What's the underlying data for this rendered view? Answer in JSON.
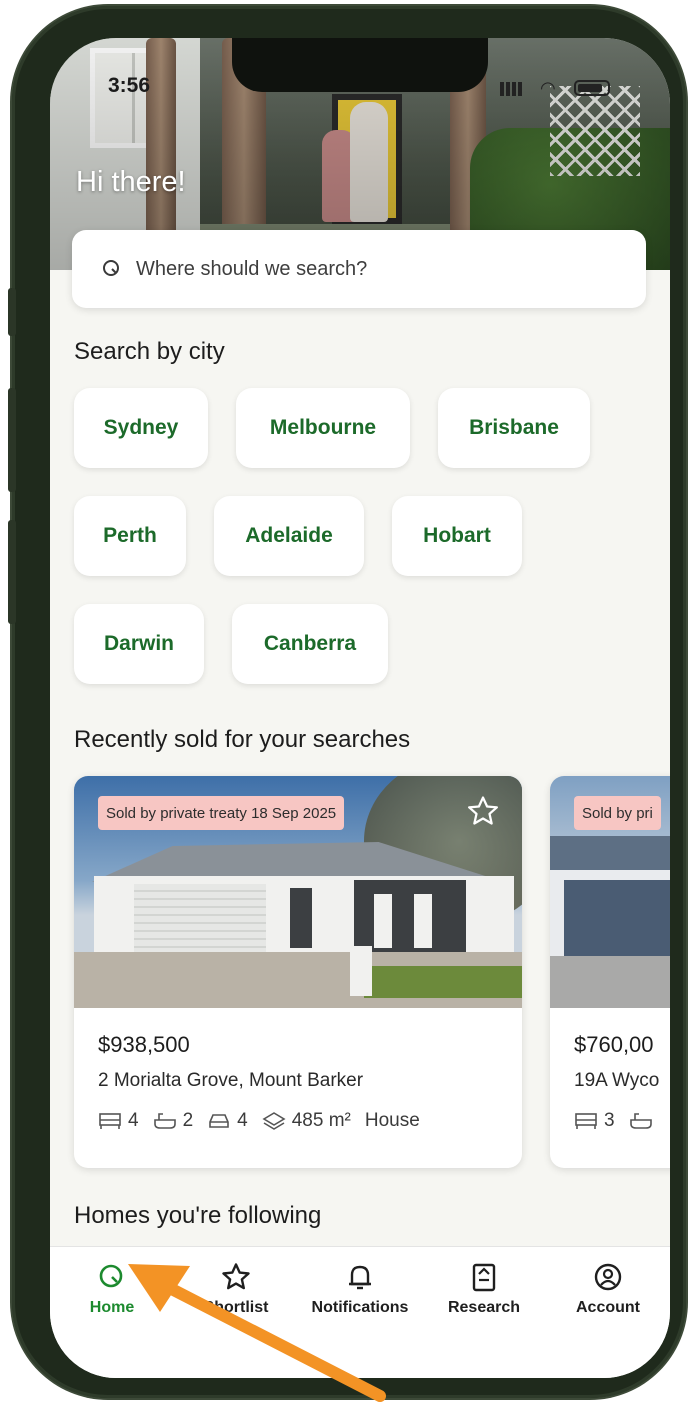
{
  "status_bar": {
    "time": "3:56"
  },
  "header": {
    "greeting": "Hi there!"
  },
  "search": {
    "placeholder": "Where should we search?"
  },
  "cities": {
    "title": "Search by city",
    "items": [
      "Sydney",
      "Melbourne",
      "Brisbane",
      "Perth",
      "Adelaide",
      "Hobart",
      "Darwin",
      "Canberra"
    ]
  },
  "recently_sold": {
    "title": "Recently sold for your searches",
    "listings": [
      {
        "sold_label": "Sold by private treaty 18 Sep 2025",
        "price": "$938,500",
        "address": "2 Morialta Grove, Mount Barker",
        "beds": "4",
        "baths": "2",
        "cars": "4",
        "land": "485 m²",
        "type": "House"
      },
      {
        "sold_label": "Sold by pri",
        "price": "$760,00",
        "address": "19A Wyco",
        "beds": "3"
      }
    ]
  },
  "following": {
    "title": "Homes you're following"
  },
  "bottom_nav": {
    "items": [
      {
        "label": "Home",
        "icon": "search-icon",
        "active": true
      },
      {
        "label": "Shortlist",
        "icon": "star-icon"
      },
      {
        "label": "Notifications",
        "icon": "bell-icon"
      },
      {
        "label": "Research",
        "icon": "clipboard-icon"
      },
      {
        "label": "Account",
        "icon": "account-icon"
      }
    ]
  },
  "colors": {
    "accent_green": "#1c6a2a",
    "nav_active": "#1c8a2e",
    "sold_tag_bg": "#f7c6c3",
    "annotation_arrow": "#f39325"
  }
}
